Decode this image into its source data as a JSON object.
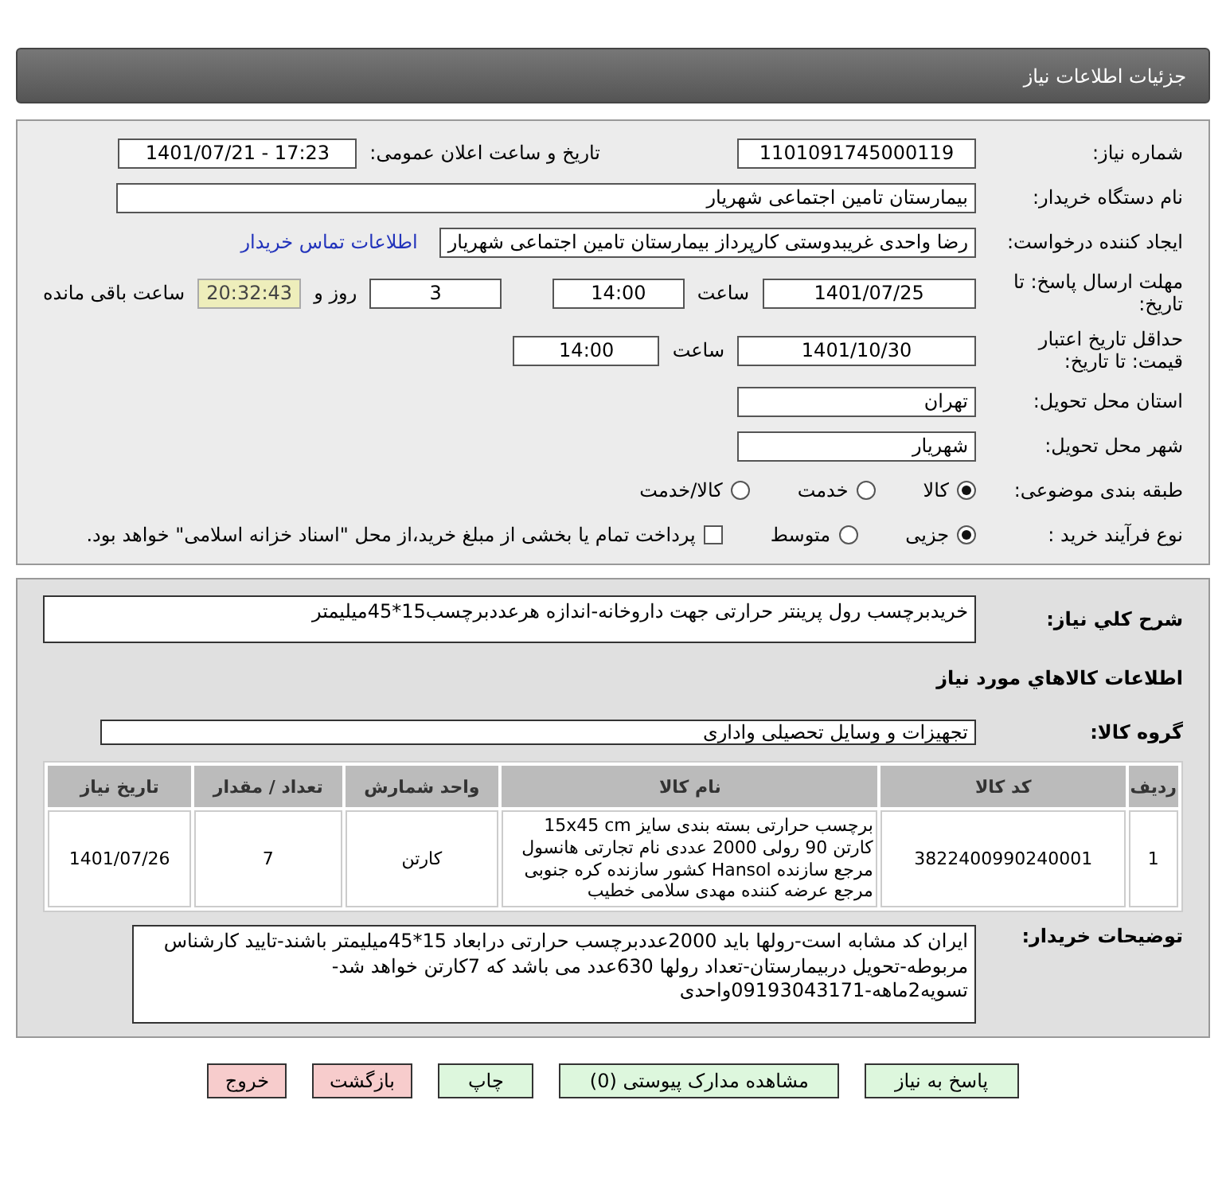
{
  "header": {
    "title": "جزئیات اطلاعات نیاز"
  },
  "details": {
    "need_number": {
      "label": "شماره نیاز:",
      "value": "1101091745000119"
    },
    "announce": {
      "label": "تاریخ و ساعت اعلان عمومی:",
      "value": "1401/07/21 - 17:23"
    },
    "buyer_org": {
      "label": "نام دستگاه خریدار:",
      "value": "بیمارستان تامین اجتماعی شهریار"
    },
    "creator": {
      "label": "ایجاد کننده درخواست:",
      "value": "رضا واحدی غریبدوستی کارپرداز بیمارستان تامین اجتماعی شهریار",
      "link": "اطلاعات تماس خریدار"
    },
    "deadline": {
      "label": "مهلت ارسال پاسخ: تا تاریخ:",
      "date": "1401/07/25",
      "time_label": "ساعت",
      "time": "14:00",
      "days": "3",
      "days_label": "روز و",
      "remaining": "20:32:43",
      "remaining_label": "ساعت باقی مانده"
    },
    "validity": {
      "label": "حداقل تاریخ اعتبار قیمت: تا تاریخ:",
      "date": "1401/10/30",
      "time_label": "ساعت",
      "time": "14:00"
    },
    "province": {
      "label": "استان محل تحویل:",
      "value": "تهران"
    },
    "city": {
      "label": "شهر محل تحویل:",
      "value": "شهریار"
    },
    "category": {
      "label": "طبقه بندی موضوعی:",
      "options": [
        {
          "label": "کالا",
          "selected": true
        },
        {
          "label": "خدمت",
          "selected": false
        },
        {
          "label": "کالا/خدمت",
          "selected": false
        }
      ]
    },
    "process": {
      "label": "نوع فرآیند خرید :",
      "options": [
        {
          "label": "جزیی",
          "selected": true
        },
        {
          "label": "متوسط",
          "selected": false
        }
      ],
      "payment": {
        "label": "پرداخت تمام یا بخشی از مبلغ خرید،از محل \"اسناد خزانه اسلامی\" خواهد بود.",
        "checked": false
      }
    }
  },
  "summary": {
    "label": "شرح کلي نياز:",
    "value": "خریدبرچسب رول پرینتر حرارتی جهت داروخانه-اندازه هرعددبرچسب15*45میلیمتر"
  },
  "goods_heading": "اطلاعات كالاهاي مورد نياز",
  "goods_group": {
    "label": "گروه کالا:",
    "value": "تجهیزات و وسایل تحصیلی واداری"
  },
  "table": {
    "columns": [
      "ردیف",
      "کد کالا",
      "نام کالا",
      "واحد شمارش",
      "تعداد / مقدار",
      "تاریخ نیاز"
    ],
    "rows": [
      [
        "1",
        "3822400990240001",
        "برچسب حرارتی بسته بندی سایز 15x45 cm کارتن 90 رولی 2000 عددی نام تجارتی هانسول مرجع سازنده Hansol کشور سازنده کره جنوبی مرجع عرضه کننده مهدی سلامی خطیب",
        "کارتن",
        "7",
        "1401/07/26"
      ]
    ]
  },
  "notes": {
    "label": "توضیحات خریدار:",
    "value": "ایران کد مشابه است-رولها باید 2000عددبرچسب حرارتی درابعاد 15*45میلیمتر باشند-تایید کارشناس مربوطه-تحویل دربیمارستان-تعداد رولها 630عدد می باشد که 7کارتن خواهد شد-تسویه2ماهه-09193043171واحدی"
  },
  "buttons": [
    {
      "label": "پاسخ به نیاز",
      "kind": "normal"
    },
    {
      "label": "مشاهده مدارک پیوستی (0)",
      "kind": "normal"
    },
    {
      "label": "چاپ",
      "kind": "normal"
    },
    {
      "label": "بازگشت",
      "kind": "exit"
    },
    {
      "label": "خروج",
      "kind": "exit"
    }
  ]
}
